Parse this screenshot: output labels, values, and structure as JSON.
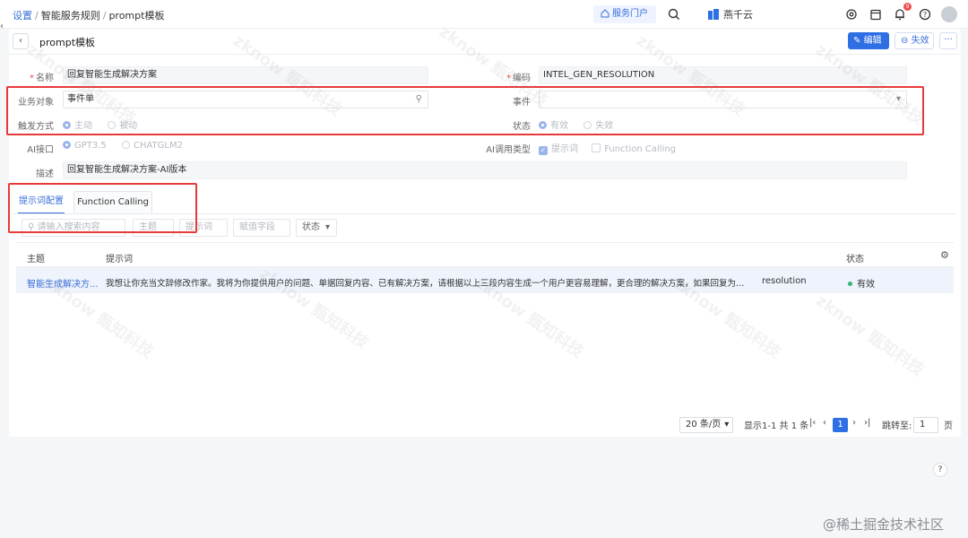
{
  "header": {
    "breadcrumb": [
      "设置",
      "智能服务规则",
      "prompt模板"
    ],
    "portal_label": "服务门户",
    "org_name": "燕千云",
    "notification_count": "9",
    "brand_color": "#2f6fe4"
  },
  "page": {
    "title": "prompt模板",
    "edit_label": "编辑",
    "disable_label": "失效",
    "more_label": "···"
  },
  "form": {
    "name_label": "名称",
    "name_value": "回复智能生成解决方案",
    "code_label": "编码",
    "code_value": "INTEL_GEN_RESOLUTION",
    "business_object_label": "业务对象",
    "business_object_value": "事件单",
    "event_label": "事件",
    "event_value": "",
    "trigger_label": "触发方式",
    "trigger_options": [
      "主动",
      "被动"
    ],
    "status_label": "状态",
    "status_options": [
      "有效",
      "失效"
    ],
    "ai_api_label": "AI接口",
    "ai_api_options": [
      "GPT3.5",
      "CHATGLM2"
    ],
    "ai_call_type_label": "AI调用类型",
    "ai_call_type_options": [
      "提示词",
      "Function Calling"
    ],
    "description_label": "描述",
    "description_value": "回复智能生成解决方案-AI版本"
  },
  "tabs": [
    {
      "label": "提示词配置",
      "active": true
    },
    {
      "label": "Function Calling",
      "active": false
    }
  ],
  "filters": {
    "search_placeholder": "请输入搜索内容",
    "subject_placeholder": "主题",
    "prompt_placeholder": "提示词",
    "assign_field_placeholder": "赋值字段",
    "status_placeholder": "状态"
  },
  "table": {
    "columns": [
      "主题",
      "提示词",
      "状态"
    ],
    "rows": [
      {
        "subject": "智能生成解决方...",
        "prompt": "我想让你充当文辞修改作家。我将为你提供用户的问题、单据回复内容、已有解决方案，请根据以上三段内容生成一个用户更容易理解，更合理的解决方案，如果回复为空，则结合已...",
        "field": "resolution",
        "status": "有效"
      }
    ]
  },
  "pagination": {
    "page_size": "20 条/页",
    "summary": "显示1-1 共 1 条",
    "current_page": "1",
    "jump_label": "跳转至:",
    "jump_value": "1",
    "page_unit": "页"
  },
  "footer_watermark": "@稀土掘金技术社区",
  "background_watermark": "zknow 甄知科技"
}
